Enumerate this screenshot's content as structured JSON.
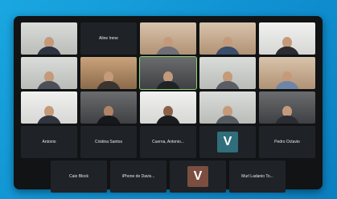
{
  "colors": {
    "background_blue": "#1aa7e0",
    "window": "#111315",
    "avatar_teal": "#2f6e7a",
    "avatar_brown": "#7b4e40",
    "active_speaker": "#8bd36f"
  },
  "participants": {
    "r1c2": "Aline Irene",
    "r4c1": "Antonio",
    "r4c2": "Cristina Santos",
    "r4c3": "Cuerna, Antonio...",
    "r4c4_avatar": "V",
    "r4c5": "Pedro Octavio",
    "r5c1": "Caio Block",
    "r5c2": "iPhone de Davis...",
    "r5c3_avatar": "V",
    "r5c4": "Murl Ladanio To..."
  }
}
